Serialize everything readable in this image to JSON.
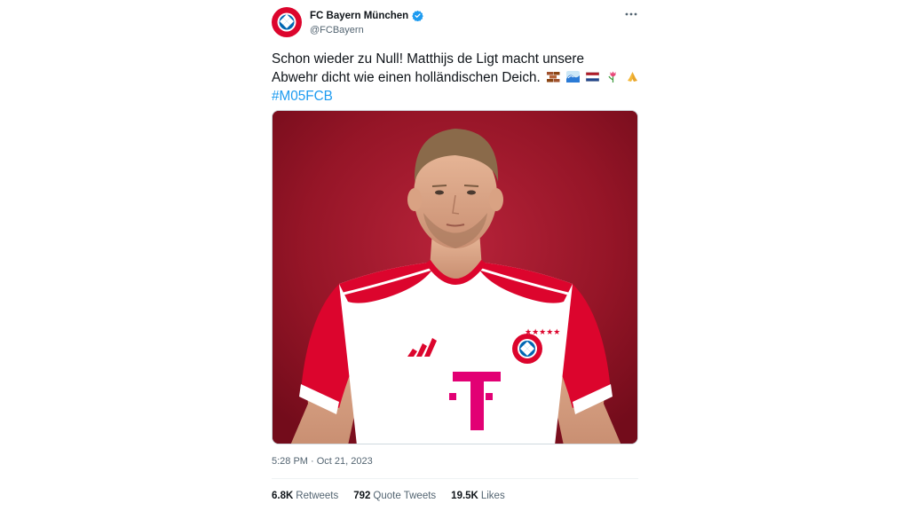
{
  "tweet": {
    "author": {
      "display_name": "FC Bayern München",
      "handle": "@FCBayern",
      "verified": true,
      "avatar_icon": "fc-bayern-crest-icon"
    },
    "more_icon": "more-dots-icon",
    "text_line1": "Schon wieder zu Null! Matthijs de Ligt macht unsere",
    "text_line2": "Abwehr dicht wie einen holländischen Deich.",
    "emojis": [
      "brick-emoji",
      "wave-emoji",
      "netherlands-flag-emoji",
      "tulip-emoji",
      "folded-hands-emoji"
    ],
    "hashtag": "#M05FCB",
    "media": {
      "subject": "player-photo",
      "jersey_sponsor": "T",
      "jersey_brand": "adidas-logo"
    },
    "timestamp": "5:28 PM · Oct 21, 2023",
    "stats": {
      "retweets_value": "6.8K",
      "retweets_label": "Retweets",
      "quotes_value": "792",
      "quotes_label": "Quote Tweets",
      "likes_value": "19.5K",
      "likes_label": "Likes"
    }
  },
  "colors": {
    "bayern_red": "#dc052d",
    "link_blue": "#1d9bf0",
    "secondary_text": "#536471",
    "telekom_magenta": "#e20074"
  }
}
